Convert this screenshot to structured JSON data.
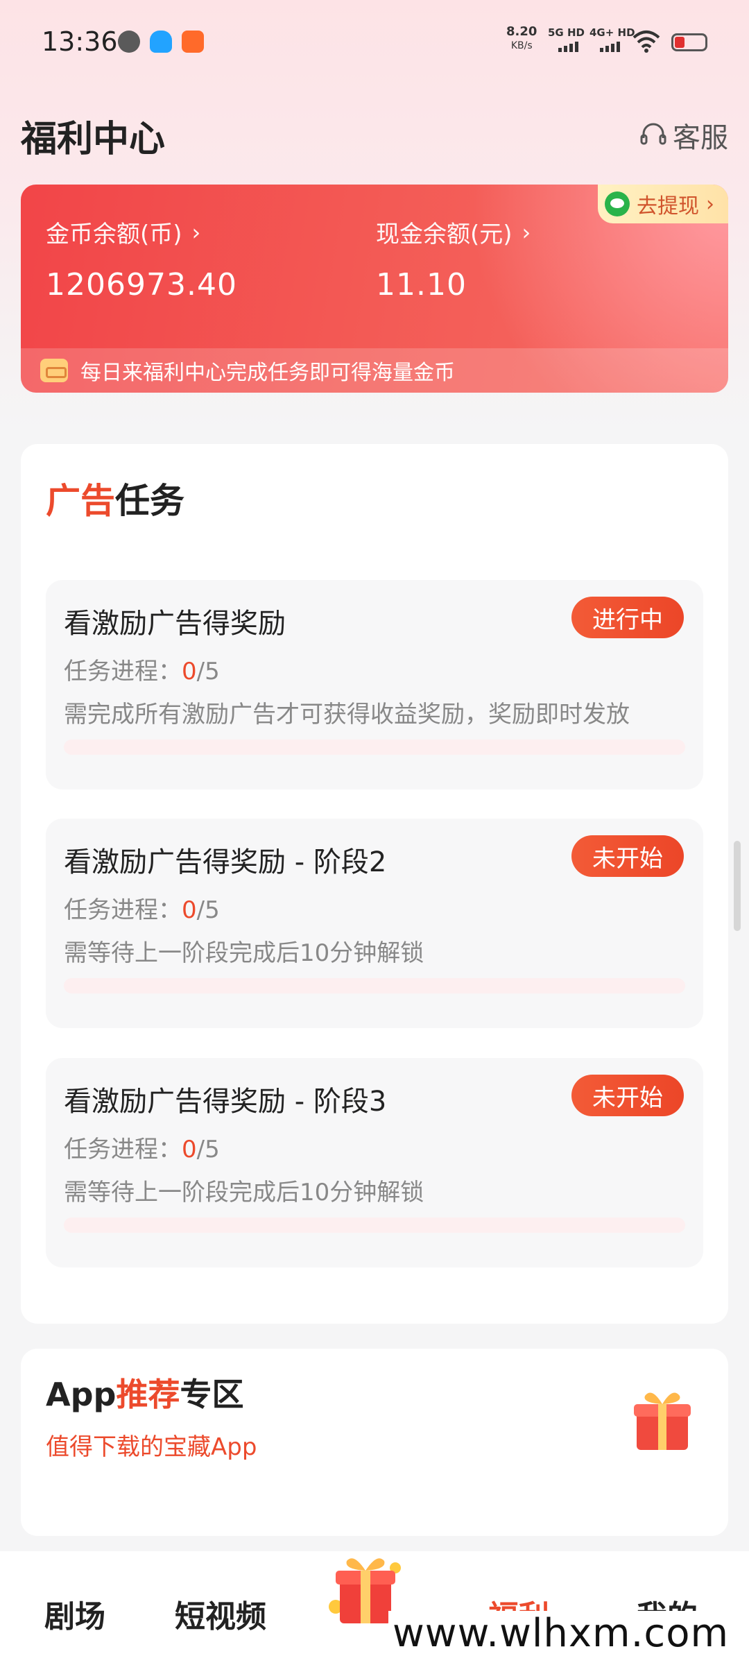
{
  "status_bar": {
    "time": "13:36",
    "net_speed": "8.20",
    "net_unit": "KB/s",
    "sim1": "5G HD",
    "sim2": "4G+ HD"
  },
  "header": {
    "title": "福利中心",
    "service_label": "客服"
  },
  "balance": {
    "coin_label": "金币余额(币)",
    "coin_value": "1206973.40",
    "cash_label": "现金余额(元)",
    "cash_value": "11.10",
    "withdraw_label": "去提现",
    "notice": "每日来福利中心完成任务即可得海量金币"
  },
  "tasks": {
    "title_accent": "广告",
    "title_rest": "任务",
    "items": [
      {
        "title": "看激励广告得奖励",
        "badge": "进行中",
        "progress_label": "任务进程：",
        "done": "0",
        "total": "/5",
        "progress": 0,
        "desc": "需完成所有激励广告才可获得收益奖励，奖励即时发放"
      },
      {
        "title": "看激励广告得奖励 - 阶段2",
        "badge": "未开始",
        "progress_label": "任务进程：",
        "done": "0",
        "total": "/5",
        "progress": 0,
        "desc": "需等待上一阶段完成后10分钟解锁"
      },
      {
        "title": "看激励广告得奖励 - 阶段3",
        "badge": "未开始",
        "progress_label": "任务进程：",
        "done": "0",
        "total": "/5",
        "progress": 0,
        "desc": "需等待上一阶段完成后10分钟解锁"
      }
    ]
  },
  "app_zone": {
    "title_pre": "App",
    "title_accent": "推荐",
    "title_post": "专区",
    "subtitle": "值得下载的宝藏App"
  },
  "nav": {
    "theater": "剧场",
    "shorts": "短视频",
    "welfare": "福利",
    "mine": "我的"
  },
  "watermark": "www.wlhxm.com",
  "colors": {
    "accent": "#ec4a2c",
    "card_red": "#f24548"
  }
}
